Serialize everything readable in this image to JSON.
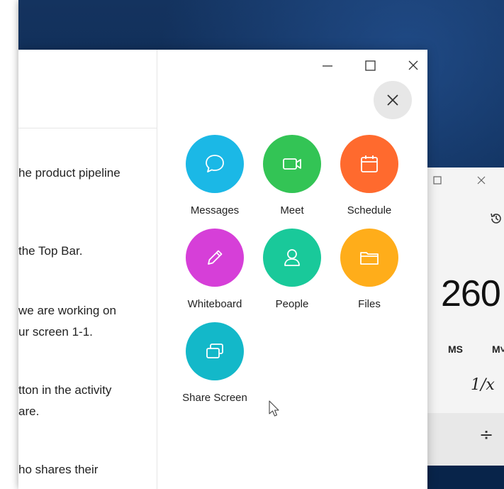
{
  "left_pane": {
    "snippets": [
      "he product pipeline",
      "the Top Bar.",
      "we are working on",
      "ur screen 1-1.",
      "tton in the activity",
      "are.",
      "ho shares their"
    ]
  },
  "menu": {
    "items": [
      {
        "label": "Messages",
        "color": "#1bb8e6",
        "icon": "chat-bubble-icon"
      },
      {
        "label": "Meet",
        "color": "#33c455",
        "icon": "video-camera-icon"
      },
      {
        "label": "Schedule",
        "color": "#ff6a2e",
        "icon": "calendar-icon"
      },
      {
        "label": "Whiteboard",
        "color": "#d63fd8",
        "icon": "pencil-icon"
      },
      {
        "label": "People",
        "color": "#19c99a",
        "icon": "person-icon"
      },
      {
        "label": "Files",
        "color": "#ffad1a",
        "icon": "folder-icon"
      },
      {
        "label": "Share Screen",
        "color": "#13b8c9",
        "icon": "share-screen-icon"
      }
    ]
  },
  "calculator": {
    "display": "260",
    "memory_buttons": [
      "MS",
      "M˅"
    ],
    "reciprocal": "1/x",
    "divide": "÷"
  }
}
